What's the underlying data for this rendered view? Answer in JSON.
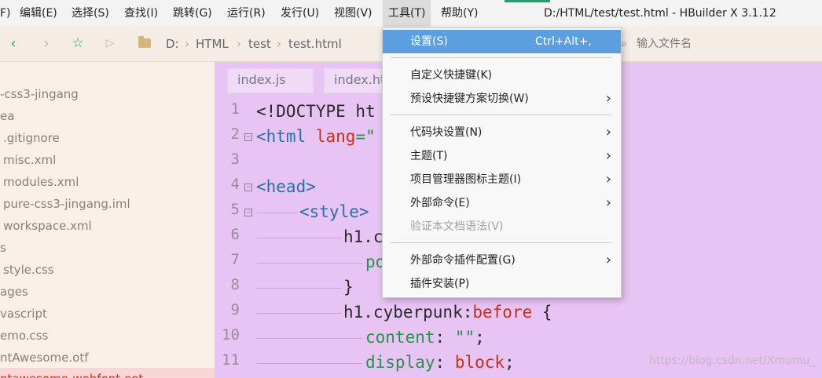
{
  "menubar": {
    "items": [
      "F)",
      "编辑(E)",
      "选择(S)",
      "查找(I)",
      "跳转(G)",
      "运行(R)",
      "发行(U)",
      "视图(V)",
      "工具(T)",
      "帮助(Y)"
    ],
    "title": "D:/HTML/test/test.html - HBuilder X 3.1.12"
  },
  "toolbar": {
    "breadcrumb": [
      "D:",
      "HTML",
      "test",
      "test.html"
    ],
    "search_placeholder": "输入文件名"
  },
  "sidebar": {
    "items": [
      "-css3-jingang",
      "ea",
      ".gitignore",
      "misc.xml",
      "modules.xml",
      "pure-css3-jingang.iml",
      "workspace.xml",
      "s",
      "style.css",
      "ages",
      "vascript",
      "emo.css",
      "ntAwesome.otf",
      "ntawesome-webfont.eot"
    ]
  },
  "editor": {
    "tabs": [
      "index.js",
      "index.ht"
    ],
    "line_numbers": [
      "1",
      "2",
      "3",
      "4",
      "5",
      "6",
      "7",
      "8",
      "9",
      "10",
      "11"
    ],
    "lines": {
      "l1_a": "<!DOCTYPE ht",
      "l2_tag": "<html",
      "l2_attr": "lang",
      "l2_eq": "=\"",
      "l4_tag": "<head>",
      "l5_tag": "<style>",
      "l6": "h1.c",
      "l7": "po",
      "l8": "}",
      "l9_sel": "h1.cyberpunk:",
      "l9_kw": "before",
      "l9_brace": " {",
      "l10_prop": "content",
      "l10_rest": ": ",
      "l10_str": "\"\"",
      "l10_end": ";",
      "l11_prop": "display",
      "l11_rest": ": ",
      "l11_val": "block",
      "l11_end": ";"
    }
  },
  "tools_menu": {
    "items": [
      {
        "label": "设置(S)",
        "shortcut": "Ctrl+Alt+,",
        "submenu": false,
        "highlighted": true,
        "disabled": false
      },
      {
        "label": "自定义快捷键(K)",
        "shortcut": "",
        "submenu": false,
        "highlighted": false,
        "disabled": false
      },
      {
        "label": "预设快捷键方案切换(W)",
        "shortcut": "",
        "submenu": true,
        "highlighted": false,
        "disabled": false
      },
      {
        "label": "代码块设置(N)",
        "shortcut": "",
        "submenu": true,
        "highlighted": false,
        "disabled": false
      },
      {
        "label": "主题(T)",
        "shortcut": "",
        "submenu": true,
        "highlighted": false,
        "disabled": false
      },
      {
        "label": "项目管理器图标主题(I)",
        "shortcut": "",
        "submenu": true,
        "highlighted": false,
        "disabled": false
      },
      {
        "label": "外部命令(E)",
        "shortcut": "",
        "submenu": true,
        "highlighted": false,
        "disabled": false
      },
      {
        "label": "验证本文档语法(V)",
        "shortcut": "",
        "submenu": false,
        "highlighted": false,
        "disabled": true
      },
      {
        "label": "外部命令插件配置(G)",
        "shortcut": "",
        "submenu": true,
        "highlighted": false,
        "disabled": false
      },
      {
        "label": "插件安装(P)",
        "shortcut": "",
        "submenu": false,
        "highlighted": false,
        "disabled": false
      }
    ]
  },
  "watermark": "https://blog.csdn.net/Xmumu_",
  "colors": {
    "accent": "#2e9a6e",
    "highlight": "#5b9fe0",
    "editor_bg": "#e8c4f4"
  }
}
